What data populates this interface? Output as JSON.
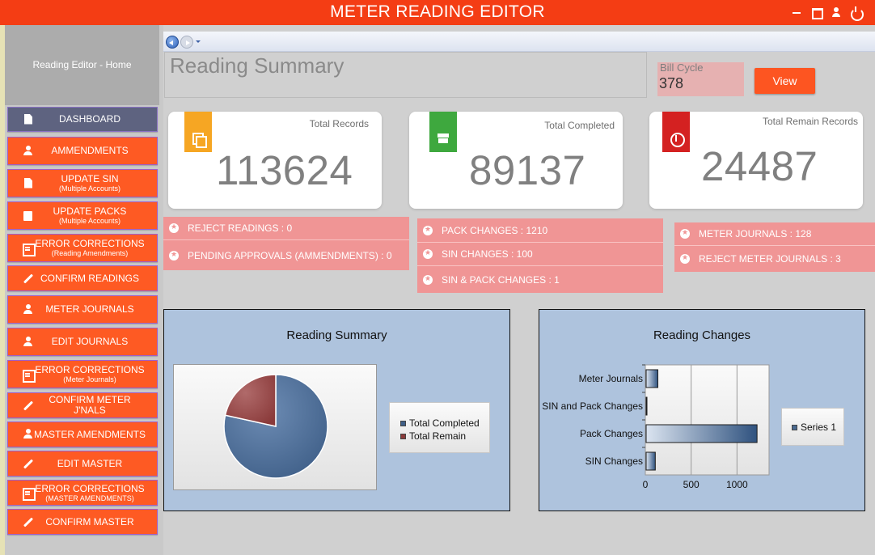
{
  "window": {
    "title": "METER READING EDITOR"
  },
  "sidebar": {
    "home": "Reading Editor - Home",
    "items": [
      {
        "label": "DASHBOARD",
        "sub": ""
      },
      {
        "label": "AMMENDMENTS",
        "sub": ""
      },
      {
        "label": "UPDATE SIN",
        "sub": "(Multiple Accounts)"
      },
      {
        "label": "UPDATE PACKS",
        "sub": "(Multiple Accounts)"
      },
      {
        "label": "ERROR CORRECTIONS",
        "sub": "(Reading Amendments)"
      },
      {
        "label": "CONFIRM READINGS",
        "sub": ""
      },
      {
        "label": "METER JOURNALS",
        "sub": ""
      },
      {
        "label": "EDIT JOURNALS",
        "sub": ""
      },
      {
        "label": "ERROR CORRECTIONS",
        "sub": "(Meter Journals)"
      },
      {
        "label": "CONFIRM METER J'NALS",
        "sub": ""
      },
      {
        "label": "MASTER AMENDMENTS",
        "sub": ""
      },
      {
        "label": "EDIT MASTER",
        "sub": ""
      },
      {
        "label": "ERROR CORRECTIONS",
        "sub": "(MASTER AMENDMENTS)"
      },
      {
        "label": "CONFIRM MASTER",
        "sub": ""
      }
    ]
  },
  "header": {
    "title": "Reading Summary",
    "bill_cycle_label": "Bill Cycle",
    "bill_cycle_value": "378",
    "view_label": "View"
  },
  "cards": [
    {
      "label": "Total Records",
      "value": "113624",
      "color": "#f6a623"
    },
    {
      "label": "Total Completed",
      "value": "89137",
      "color": "#3ea83e"
    },
    {
      "label": "Total Remain Records",
      "value": "24487",
      "color": "#d42121"
    }
  ],
  "stats": {
    "group1": [
      "REJECT READINGS : 0",
      "PENDING APPROVALS (AMMENDMENTS) : 0"
    ],
    "group2": [
      "PACK CHANGES : 1210",
      "SIN CHANGES : 100",
      "SIN & PACK CHANGES : 1"
    ],
    "group3": [
      "METER JOURNALS : 128",
      "REJECT METER JOURNALS : 3"
    ]
  },
  "charts": {
    "pie_title": "Reading Summary",
    "bar_title": "Reading Changes"
  },
  "chart_data": [
    {
      "type": "pie",
      "title": "Reading Summary",
      "categories": [
        "Total Completed",
        "Total Remain"
      ],
      "values": [
        89137,
        24487
      ],
      "colors": [
        "#3f5f88",
        "#8a3a3a"
      ],
      "legend": "right"
    },
    {
      "type": "bar",
      "orientation": "horizontal",
      "title": "Reading Changes",
      "categories": [
        "Meter Journals",
        "SIN and Pack Changes",
        "Pack Changes",
        "SIN Changes"
      ],
      "series": [
        {
          "name": "Series 1",
          "values": [
            128,
            1,
            1210,
            100
          ]
        }
      ],
      "xlim": [
        0,
        1350
      ],
      "xticks": [
        "0",
        "500",
        "1000"
      ],
      "grid": true,
      "legend": "right"
    }
  ]
}
